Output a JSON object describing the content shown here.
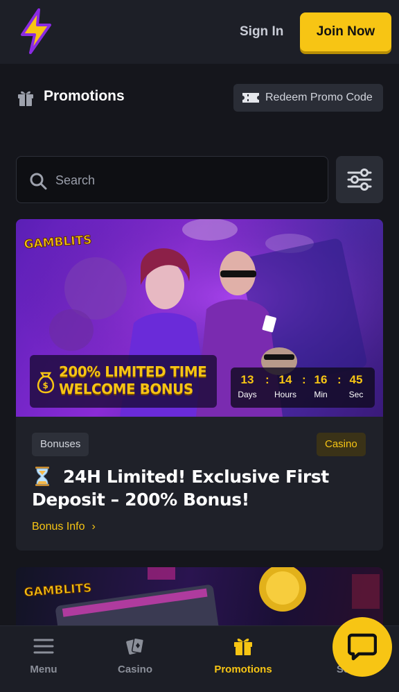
{
  "header": {
    "sign_in": "Sign In",
    "join_now": "Join Now",
    "logo_icon": "lightning-bolt-logo"
  },
  "page": {
    "title": "Promotions",
    "title_icon": "gift-icon",
    "redeem_label": "Redeem Promo Code",
    "redeem_icon": "ticket-icon"
  },
  "search": {
    "placeholder": "Search",
    "icon": "search-icon",
    "filter_icon": "sliders-icon"
  },
  "promo_card": {
    "brand": "GAMBLITS",
    "headline_line1": "200% LIMITED TIME",
    "headline_line2": "WELCOME BONUS",
    "countdown": {
      "days": "13",
      "hours": "14",
      "minutes": "16",
      "seconds": "45",
      "days_label": "Days",
      "hours_label": "Hours",
      "minutes_label": "Min",
      "seconds_label": "Sec",
      "separator": ":"
    },
    "tag_left": "Bonuses",
    "tag_right": "Casino",
    "title": "24H Limited! Exclusive First Deposit – 200% Bonus!",
    "link": "Bonus Info",
    "link_chevron": "›"
  },
  "promo_card_2": {
    "brand": "GAMBLITS"
  },
  "bottom_nav": {
    "items": [
      {
        "label": "Menu",
        "icon": "hamburger-icon"
      },
      {
        "label": "Casino",
        "icon": "cards-icon"
      },
      {
        "label": "Promotions",
        "icon": "gift-icon",
        "active": true
      },
      {
        "label": "Se",
        "icon": "search-icon"
      }
    ],
    "chat_icon": "chat-bubble-icon"
  },
  "colors": {
    "accent": "#f7c514",
    "background": "#15161c",
    "surface": "#1f2129",
    "header": "#1d1f27"
  }
}
